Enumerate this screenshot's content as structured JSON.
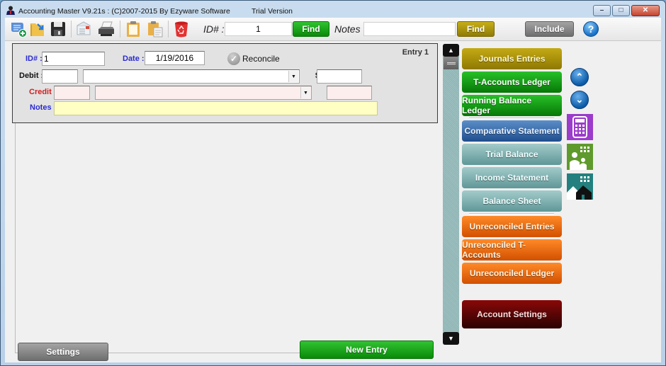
{
  "titlebar": {
    "title": "Accounting Master V9.21s : (C)2007-2015 By Ezyware Software",
    "trial": "Trial Version",
    "minimize": "–",
    "maximize": "□",
    "close": "✕"
  },
  "toolbar": {
    "icons": [
      "new-entry-icon",
      "open-folder-icon",
      "save-icon",
      "print-preview-icon",
      "printer-icon",
      "copy-icon",
      "paste-icon",
      "delete-icon"
    ],
    "id_label": "ID# :",
    "id_value": "1",
    "find_label": "Find",
    "notes_label": "Notes :",
    "notes_value": "",
    "notes_find_label": "Find",
    "include_label": "Include",
    "help_glyph": "?"
  },
  "entry": {
    "id_label": "ID# :",
    "id_value": "1",
    "date_label": "Date :",
    "date_value": "1/19/2016",
    "reconcile_label": "Reconcile",
    "entry_number": "Entry 1",
    "debit_label": "Debit :",
    "debit_code": "",
    "debit_account": "",
    "debit_amount": "",
    "dollar_sign": "$",
    "credit_label": "Credit :",
    "credit_code": "",
    "credit_account": "",
    "credit_amount": "",
    "notes_label": "Notes :",
    "notes_value": ""
  },
  "nav": {
    "journals": "Journals Entries",
    "t_accounts": "T-Accounts Ledger",
    "running_balance": "Running Balance Ledger",
    "comparative": "Comparative Statement",
    "trial_balance": "Trial Balance",
    "income_statement": "Income Statement",
    "balance_sheet": "Balance Sheet",
    "unreconciled_entries": "Unreconciled Entries",
    "unreconciled_taccounts": "Unreconciled T-Accounts",
    "unreconciled_ledger": "Unreconciled Ledger",
    "account_settings": "Account Settings"
  },
  "side_icons": {
    "up": "⌃",
    "down": "⌄"
  },
  "footer": {
    "settings_label": "Settings",
    "new_entry_label": "New Entry"
  },
  "colors": {
    "olive": "#a89108",
    "green": "#0f9a0f",
    "blue": "#2f62a6",
    "teal": "#7fb0b0",
    "orange": "#ea6a0c",
    "maroon": "#5a0404",
    "calculator_tile": "#9b3ccb",
    "people_tile": "#5f9a2c",
    "house_tile": "#23807e"
  }
}
